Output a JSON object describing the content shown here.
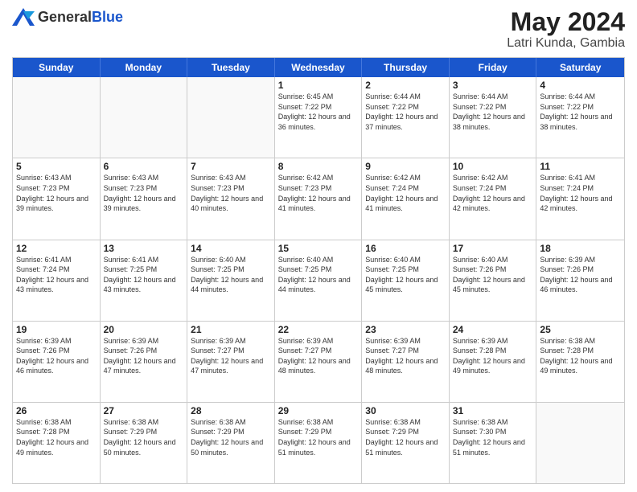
{
  "header": {
    "logo_general": "General",
    "logo_blue": "Blue",
    "title": "May 2024",
    "location": "Latri Kunda, Gambia"
  },
  "weekdays": [
    "Sunday",
    "Monday",
    "Tuesday",
    "Wednesday",
    "Thursday",
    "Friday",
    "Saturday"
  ],
  "rows": [
    [
      {
        "day": "",
        "empty": true
      },
      {
        "day": "",
        "empty": true
      },
      {
        "day": "",
        "empty": true
      },
      {
        "day": "1",
        "sunrise": "6:45 AM",
        "sunset": "7:22 PM",
        "daylight": "12 hours and 36 minutes."
      },
      {
        "day": "2",
        "sunrise": "6:44 AM",
        "sunset": "7:22 PM",
        "daylight": "12 hours and 37 minutes."
      },
      {
        "day": "3",
        "sunrise": "6:44 AM",
        "sunset": "7:22 PM",
        "daylight": "12 hours and 38 minutes."
      },
      {
        "day": "4",
        "sunrise": "6:44 AM",
        "sunset": "7:22 PM",
        "daylight": "12 hours and 38 minutes."
      }
    ],
    [
      {
        "day": "5",
        "sunrise": "6:43 AM",
        "sunset": "7:23 PM",
        "daylight": "12 hours and 39 minutes."
      },
      {
        "day": "6",
        "sunrise": "6:43 AM",
        "sunset": "7:23 PM",
        "daylight": "12 hours and 39 minutes."
      },
      {
        "day": "7",
        "sunrise": "6:43 AM",
        "sunset": "7:23 PM",
        "daylight": "12 hours and 40 minutes."
      },
      {
        "day": "8",
        "sunrise": "6:42 AM",
        "sunset": "7:23 PM",
        "daylight": "12 hours and 41 minutes."
      },
      {
        "day": "9",
        "sunrise": "6:42 AM",
        "sunset": "7:24 PM",
        "daylight": "12 hours and 41 minutes."
      },
      {
        "day": "10",
        "sunrise": "6:42 AM",
        "sunset": "7:24 PM",
        "daylight": "12 hours and 42 minutes."
      },
      {
        "day": "11",
        "sunrise": "6:41 AM",
        "sunset": "7:24 PM",
        "daylight": "12 hours and 42 minutes."
      }
    ],
    [
      {
        "day": "12",
        "sunrise": "6:41 AM",
        "sunset": "7:24 PM",
        "daylight": "12 hours and 43 minutes."
      },
      {
        "day": "13",
        "sunrise": "6:41 AM",
        "sunset": "7:25 PM",
        "daylight": "12 hours and 43 minutes."
      },
      {
        "day": "14",
        "sunrise": "6:40 AM",
        "sunset": "7:25 PM",
        "daylight": "12 hours and 44 minutes."
      },
      {
        "day": "15",
        "sunrise": "6:40 AM",
        "sunset": "7:25 PM",
        "daylight": "12 hours and 44 minutes."
      },
      {
        "day": "16",
        "sunrise": "6:40 AM",
        "sunset": "7:25 PM",
        "daylight": "12 hours and 45 minutes."
      },
      {
        "day": "17",
        "sunrise": "6:40 AM",
        "sunset": "7:26 PM",
        "daylight": "12 hours and 45 minutes."
      },
      {
        "day": "18",
        "sunrise": "6:39 AM",
        "sunset": "7:26 PM",
        "daylight": "12 hours and 46 minutes."
      }
    ],
    [
      {
        "day": "19",
        "sunrise": "6:39 AM",
        "sunset": "7:26 PM",
        "daylight": "12 hours and 46 minutes."
      },
      {
        "day": "20",
        "sunrise": "6:39 AM",
        "sunset": "7:26 PM",
        "daylight": "12 hours and 47 minutes."
      },
      {
        "day": "21",
        "sunrise": "6:39 AM",
        "sunset": "7:27 PM",
        "daylight": "12 hours and 47 minutes."
      },
      {
        "day": "22",
        "sunrise": "6:39 AM",
        "sunset": "7:27 PM",
        "daylight": "12 hours and 48 minutes."
      },
      {
        "day": "23",
        "sunrise": "6:39 AM",
        "sunset": "7:27 PM",
        "daylight": "12 hours and 48 minutes."
      },
      {
        "day": "24",
        "sunrise": "6:39 AM",
        "sunset": "7:28 PM",
        "daylight": "12 hours and 49 minutes."
      },
      {
        "day": "25",
        "sunrise": "6:38 AM",
        "sunset": "7:28 PM",
        "daylight": "12 hours and 49 minutes."
      }
    ],
    [
      {
        "day": "26",
        "sunrise": "6:38 AM",
        "sunset": "7:28 PM",
        "daylight": "12 hours and 49 minutes."
      },
      {
        "day": "27",
        "sunrise": "6:38 AM",
        "sunset": "7:29 PM",
        "daylight": "12 hours and 50 minutes."
      },
      {
        "day": "28",
        "sunrise": "6:38 AM",
        "sunset": "7:29 PM",
        "daylight": "12 hours and 50 minutes."
      },
      {
        "day": "29",
        "sunrise": "6:38 AM",
        "sunset": "7:29 PM",
        "daylight": "12 hours and 51 minutes."
      },
      {
        "day": "30",
        "sunrise": "6:38 AM",
        "sunset": "7:29 PM",
        "daylight": "12 hours and 51 minutes."
      },
      {
        "day": "31",
        "sunrise": "6:38 AM",
        "sunset": "7:30 PM",
        "daylight": "12 hours and 51 minutes."
      },
      {
        "day": "",
        "empty": true
      }
    ]
  ]
}
